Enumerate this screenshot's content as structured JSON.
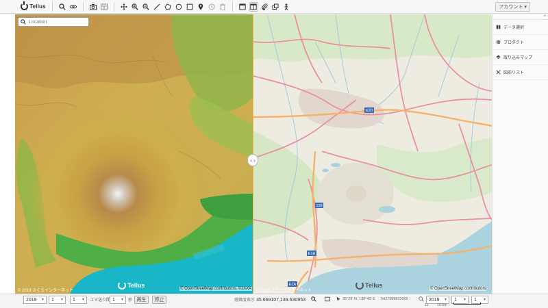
{
  "toolbar": {
    "logo_text": "Tellus",
    "account_label": "アカウント",
    "icons": [
      "search-icon",
      "link-icon",
      "camera-icon",
      "grid-icon",
      "move-icon",
      "zoom-in-icon",
      "zoom-out-icon",
      "line-icon",
      "polygon-icon",
      "circle-icon",
      "rectangle-icon",
      "pin-icon",
      "clock-icon",
      "trash-icon",
      "window-icon",
      "split-view-icon",
      "paperclip-icon",
      "layers-icon",
      "person-icon"
    ]
  },
  "search": {
    "placeholder": "Location",
    "value": ""
  },
  "split": {
    "handle_label": "‹ ›"
  },
  "map_left": {
    "attribution_left": "© 2019 さくらインターネット",
    "attribution_right": "© OpenStreetMap contributors, ©JAXA",
    "logo_text": "Tellus"
  },
  "map_right": {
    "attribution_left": "© 2019 さくらインターネット",
    "attribution_right": "© OpenStreetMap contributors",
    "logo_text": "Tellus",
    "route_labels": [
      "E20",
      "139",
      "E1A",
      "E1A"
    ]
  },
  "panel": {
    "header": "+",
    "items": [
      {
        "label": "データ選択",
        "icon": "book-icon"
      },
      {
        "label": "プロダクト",
        "icon": "globe-icon"
      },
      {
        "label": "取り込みマップ",
        "icon": "stack-icon"
      },
      {
        "label": "図形リスト",
        "icon": "shapes-icon"
      }
    ]
  },
  "bottombar": {
    "left": {
      "year": "2019",
      "month": "1",
      "day": "1",
      "interval_label": "コマ送り間隔",
      "interval_value": "1",
      "unit_label": "秒",
      "play_label": "再生",
      "stop_label": "停止"
    },
    "coords_label": "経緯度表示",
    "coords_value": "35.669107,139.630953",
    "dms_value": "35°29' N, 138°40' E",
    "mesh_value": "5437388833000",
    "zoom_value": "11",
    "scale_label": "10 km",
    "right": {
      "year": "2019",
      "month": "1",
      "day": "1"
    }
  }
}
